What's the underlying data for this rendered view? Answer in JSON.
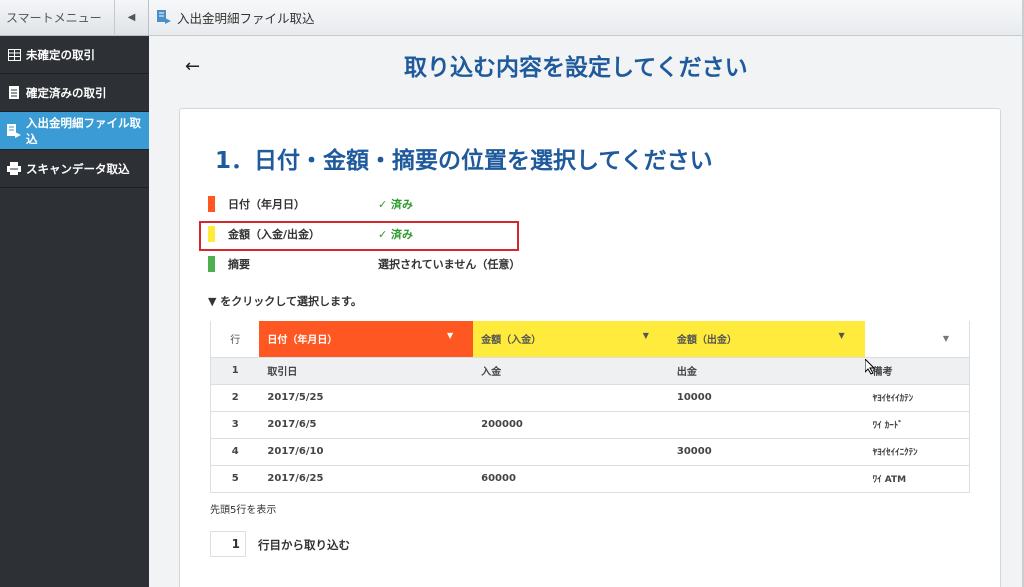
{
  "sidebar": {
    "title": "スマートメニュー",
    "collapse_icon": "chevron-left-icon",
    "items": [
      {
        "label": "未確定の取引",
        "icon": "grid-icon",
        "active": false
      },
      {
        "label": "確定済みの取引",
        "icon": "document-icon",
        "active": false
      },
      {
        "label": "入出金明細ファイル取込",
        "icon": "file-import-icon",
        "active": true
      },
      {
        "label": "スキャンデータ取込",
        "icon": "scanner-icon",
        "active": false
      }
    ]
  },
  "topbar": {
    "icon": "file-import-icon",
    "title": "入出金明細ファイル取込"
  },
  "main": {
    "back_label": "←",
    "page_title": "取り込む内容を設定してください",
    "section_title": "1．日付・金額・摘要の位置を選択してください",
    "legend": [
      {
        "label": "日付（年月日）",
        "status": "✓ 済み",
        "color": "#ff5722"
      },
      {
        "label": "金額（入金/出金）",
        "status": "✓ 済み",
        "color": "#ffeb3b"
      },
      {
        "label": "摘要",
        "status": "選択されていません（任意）",
        "color": "#4caf50"
      }
    ],
    "hint": "▼ をクリックして選択します。",
    "table": {
      "header": {
        "row_label": "行",
        "columns": [
          "日付（年月日）",
          "金額（入金）",
          "金額（出金）",
          ""
        ],
        "dropdown_icon": "▼"
      },
      "rows": [
        [
          "1",
          "取引日",
          "入金",
          "出金",
          "備考"
        ],
        [
          "2",
          "2017/5/25",
          "",
          "10000",
          "ﾔﾖｲｾｲｲｶﾃﾝ"
        ],
        [
          "3",
          "2017/6/5",
          "200000",
          "",
          "ﾜｲ ｶｰﾄﾞ"
        ],
        [
          "4",
          "2017/6/10",
          "",
          "30000",
          "ﾔﾖｲｾｲｲﾆｸﾃﾝ"
        ],
        [
          "5",
          "2017/6/25",
          "60000",
          "",
          "ﾜｲ ATM"
        ]
      ]
    },
    "note": "先頭5行を表示",
    "start_row": {
      "value": "1",
      "label": "行目から取り込む"
    }
  }
}
